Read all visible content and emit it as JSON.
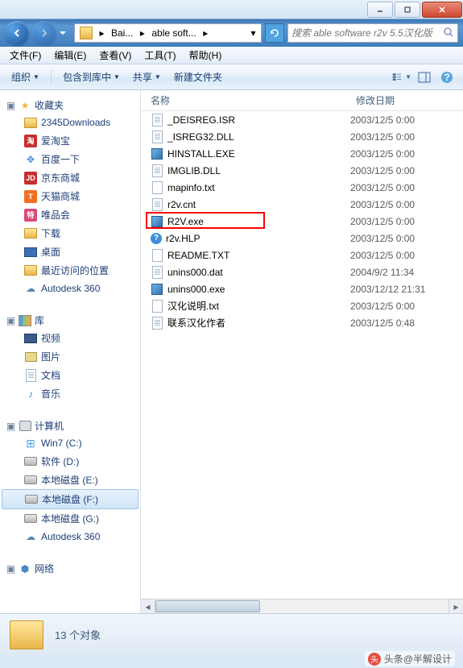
{
  "title_buttons": {
    "min": "_",
    "max": "□",
    "close": "×"
  },
  "breadcrumb": {
    "seg1": "Bai...",
    "seg2": "able soft..."
  },
  "search": {
    "placeholder": "搜索 able software r2v 5.5汉化版"
  },
  "menubar": {
    "file": "文件(F)",
    "edit": "编辑(E)",
    "view": "查看(V)",
    "tools": "工具(T)",
    "help": "帮助(H)"
  },
  "toolbar": {
    "organize": "组织",
    "include": "包含到库中",
    "share": "共享",
    "newfolder": "新建文件夹"
  },
  "columns": {
    "name": "名称",
    "date": "修改日期"
  },
  "sidebar": {
    "favorites": {
      "label": "收藏夹",
      "items": [
        {
          "icon": "folder",
          "label": "2345Downloads"
        },
        {
          "icon": "red",
          "glyph": "淘",
          "label": "爱淘宝"
        },
        {
          "icon": "paw",
          "label": "百度一下"
        },
        {
          "icon": "red",
          "glyph": "JD",
          "label": "京东商城"
        },
        {
          "icon": "orange",
          "glyph": "T",
          "label": "天猫商城"
        },
        {
          "icon": "pink",
          "glyph": "特",
          "label": "唯品会"
        },
        {
          "icon": "folder",
          "label": "下载"
        },
        {
          "icon": "desktop",
          "label": "桌面"
        },
        {
          "icon": "folder",
          "label": "最近访问的位置"
        },
        {
          "icon": "cloud",
          "label": "Autodesk 360"
        }
      ]
    },
    "libraries": {
      "label": "库",
      "items": [
        {
          "icon": "video",
          "label": "视频"
        },
        {
          "icon": "pic",
          "label": "图片"
        },
        {
          "icon": "doc",
          "label": "文档"
        },
        {
          "icon": "music",
          "label": "音乐"
        }
      ]
    },
    "computer": {
      "label": "计算机",
      "items": [
        {
          "icon": "win",
          "label": "Win7 (C:)"
        },
        {
          "icon": "drive",
          "label": "软件 (D:)"
        },
        {
          "icon": "drive",
          "label": "本地磁盘 (E:)"
        },
        {
          "icon": "drive",
          "label": "本地磁盘 (F:)",
          "selected": true
        },
        {
          "icon": "drive",
          "label": "本地磁盘 (G:)"
        },
        {
          "icon": "cloud",
          "label": "Autodesk 360"
        }
      ]
    },
    "network": {
      "label": "网络"
    }
  },
  "files": [
    {
      "icon": "doc",
      "name": "_DEISREG.ISR",
      "date": "2003/12/5 0:00"
    },
    {
      "icon": "doc",
      "name": "_ISREG32.DLL",
      "date": "2003/12/5 0:00"
    },
    {
      "icon": "exe",
      "name": "HINSTALL.EXE",
      "date": "2003/12/5 0:00"
    },
    {
      "icon": "doc",
      "name": "IMGLIB.DLL",
      "date": "2003/12/5 0:00"
    },
    {
      "icon": "txt",
      "name": "mapinfo.txt",
      "date": "2003/12/5 0:00"
    },
    {
      "icon": "doc",
      "name": "r2v.cnt",
      "date": "2003/12/5 0:00"
    },
    {
      "icon": "exe",
      "name": "R2V.exe",
      "date": "2003/12/5 0:00",
      "highlighted": true
    },
    {
      "icon": "hlp",
      "name": "r2v.HLP",
      "date": "2003/12/5 0:00"
    },
    {
      "icon": "txt",
      "name": "README.TXT",
      "date": "2003/12/5 0:00"
    },
    {
      "icon": "doc",
      "name": "unins000.dat",
      "date": "2004/9/2 11:34"
    },
    {
      "icon": "exe",
      "name": "unins000.exe",
      "date": "2003/12/12 21:31"
    },
    {
      "icon": "txt",
      "name": "汉化说明.txt",
      "date": "2003/12/5 0:00"
    },
    {
      "icon": "doc",
      "name": "联系汉化作者",
      "date": "2003/12/5 0:48"
    }
  ],
  "status": {
    "text": "13 个对象"
  },
  "watermark": {
    "text": "头条@半解设计"
  }
}
